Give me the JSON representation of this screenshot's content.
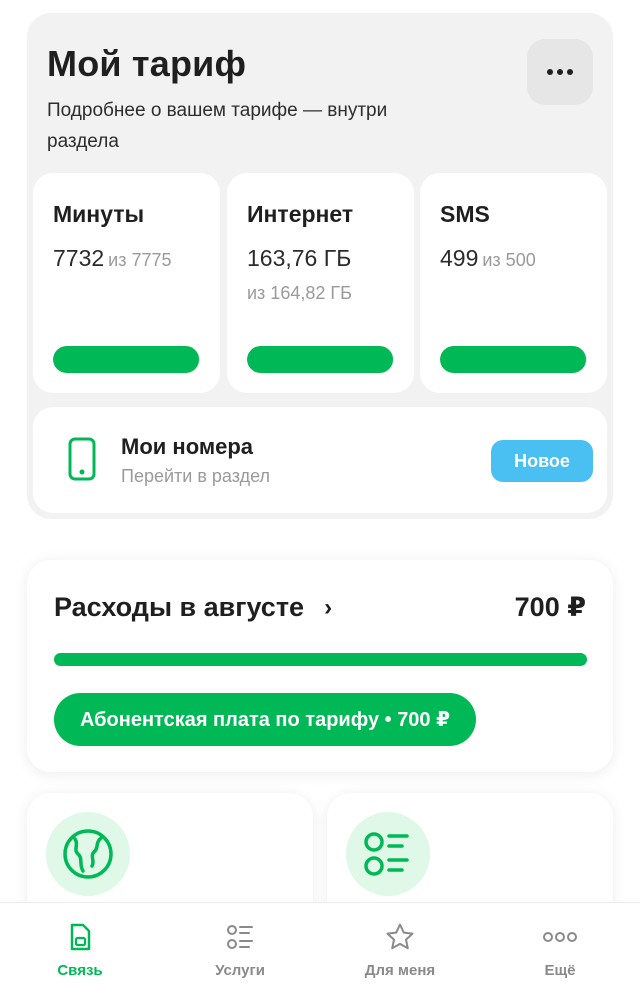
{
  "tariff": {
    "title": "Мой тариф",
    "subtitle": "Подробнее о вашем тарифе — внутри раздела",
    "menu_icon": "more-icon"
  },
  "stats": [
    {
      "name": "Минуты",
      "value": "7732",
      "of": "из 7775",
      "fill": 0.99
    },
    {
      "name": "Интернет",
      "value": "163,76 ГБ",
      "of": "из 164,82 ГБ",
      "fill": 0.99
    },
    {
      "name": "SMS",
      "value": "499",
      "of": "из 500",
      "fill": 0.99
    }
  ],
  "my_numbers": {
    "title": "Мои номера",
    "subtitle": "Перейти в раздел",
    "badge": "Новое",
    "icon": "phone-icon"
  },
  "expenses": {
    "title": "Расходы в августе",
    "chevron": "›",
    "amount": "700 ₽",
    "fee_label": "Абонентская плата по тарифу • 700 ₽",
    "fill": 1.0
  },
  "tiles": [
    {
      "icon": "globe-icon"
    },
    {
      "icon": "services-list-icon"
    }
  ],
  "nav": [
    {
      "label": "Связь",
      "icon": "sim-card-icon",
      "active": true
    },
    {
      "label": "Услуги",
      "icon": "services-list-icon",
      "active": false
    },
    {
      "label": "Для меня",
      "icon": "star-icon",
      "active": false
    },
    {
      "label": "Ещё",
      "icon": "more-icon",
      "active": false
    }
  ],
  "colors": {
    "accent": "#00b956",
    "badge": "#49bff2",
    "card_bg": "#f2f2f2",
    "muted_text": "#9a9a9a"
  }
}
